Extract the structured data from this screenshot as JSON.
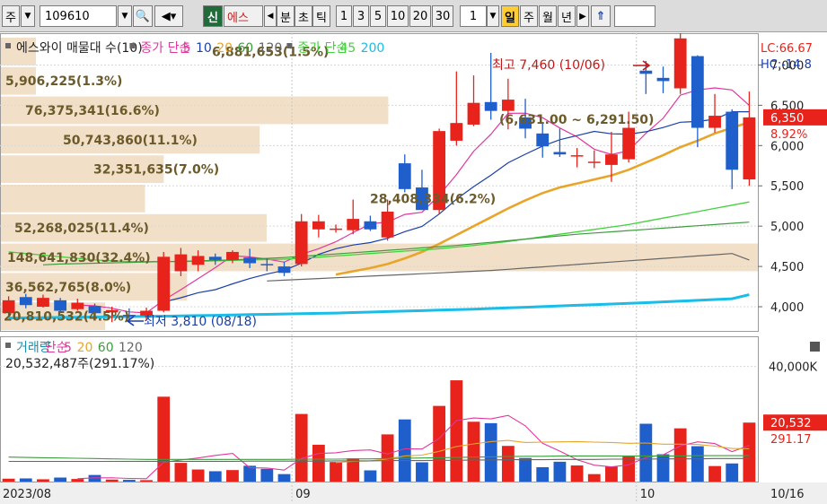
{
  "toolbar": {
    "market": "주",
    "code": "109610",
    "new_badge": "신",
    "name": "에스",
    "period_buttons": [
      "분",
      "초",
      "틱",
      "1",
      "3",
      "5",
      "10",
      "20",
      "30"
    ],
    "count": "1",
    "timeframes": [
      "일",
      "주",
      "월",
      "년"
    ],
    "selected_timeframe": "일"
  },
  "legend": {
    "price": {
      "name": "에스와이 매물대 수(10)",
      "ma_label": "종가 단순",
      "ma_periods": [
        "5",
        "10",
        "20",
        "60",
        "120"
      ],
      "ma_label2": "종가 단순",
      "ma_periods2": [
        "45",
        "200"
      ]
    },
    "volume": {
      "name": "거래량",
      "ma_label": "단순",
      "ma_periods": [
        "5",
        "20",
        "60",
        "120"
      ],
      "value": "20,532,487주(291.17%)"
    }
  },
  "colors": {
    "up": "#e8231b",
    "down": "#1f5fcc",
    "ma5": "#e0389e",
    "ma10": "#1a3fa8",
    "ma20": "#e8a52a",
    "ma60": "#3f9b3f",
    "ma120": "#666666",
    "ma45": "#44d13e",
    "ma200": "#19bde8",
    "volume_profile": "#f2dfc7"
  },
  "chart_data": [
    {
      "type": "candlestick",
      "title": "에스와이 매물대 수(10)",
      "x_labels": [
        "2023/08",
        "09",
        "10",
        "10/16"
      ],
      "ylim": [
        3700,
        7350
      ],
      "y_ticks": [
        "4,000",
        "4,500",
        "5,000",
        "5,500",
        "6,000",
        "6,500",
        "7,000"
      ],
      "candles": [
        {
          "o": 3920,
          "h": 4130,
          "l": 3880,
          "c": 4080
        },
        {
          "o": 4120,
          "h": 4160,
          "l": 3980,
          "c": 4020
        },
        {
          "o": 4000,
          "h": 4150,
          "l": 3990,
          "c": 4110
        },
        {
          "o": 4080,
          "h": 4110,
          "l": 3920,
          "c": 3950
        },
        {
          "o": 3970,
          "h": 4100,
          "l": 3950,
          "c": 4050
        },
        {
          "o": 4010,
          "h": 4040,
          "l": 3860,
          "c": 3920
        },
        {
          "o": 3930,
          "h": 4000,
          "l": 3810,
          "c": 3960
        },
        {
          "o": 3900,
          "h": 3980,
          "l": 3840,
          "c": 3880
        },
        {
          "o": 3890,
          "h": 3990,
          "l": 3830,
          "c": 3950
        },
        {
          "o": 3950,
          "h": 4680,
          "l": 3930,
          "c": 4620
        },
        {
          "o": 4440,
          "h": 4730,
          "l": 4380,
          "c": 4650
        },
        {
          "o": 4520,
          "h": 4700,
          "l": 4440,
          "c": 4630
        },
        {
          "o": 4620,
          "h": 4660,
          "l": 4520,
          "c": 4580
        },
        {
          "o": 4580,
          "h": 4700,
          "l": 4540,
          "c": 4680
        },
        {
          "o": 4610,
          "h": 4720,
          "l": 4480,
          "c": 4540
        },
        {
          "o": 4530,
          "h": 4600,
          "l": 4440,
          "c": 4520
        },
        {
          "o": 4500,
          "h": 4560,
          "l": 4380,
          "c": 4420
        },
        {
          "o": 4530,
          "h": 5150,
          "l": 4500,
          "c": 5060
        },
        {
          "o": 4960,
          "h": 5140,
          "l": 4860,
          "c": 5060
        },
        {
          "o": 4960,
          "h": 5020,
          "l": 4920,
          "c": 4970
        },
        {
          "o": 4950,
          "h": 5330,
          "l": 4900,
          "c": 5090
        },
        {
          "o": 5060,
          "h": 5130,
          "l": 4940,
          "c": 4960
        },
        {
          "o": 4860,
          "h": 5330,
          "l": 4820,
          "c": 5180
        },
        {
          "o": 5780,
          "h": 5890,
          "l": 5420,
          "c": 5460
        },
        {
          "o": 5480,
          "h": 5700,
          "l": 5200,
          "c": 5200
        },
        {
          "o": 5200,
          "h": 6210,
          "l": 5150,
          "c": 6180
        },
        {
          "o": 6060,
          "h": 6920,
          "l": 6000,
          "c": 6280
        },
        {
          "o": 6260,
          "h": 6870,
          "l": 6240,
          "c": 6530
        },
        {
          "o": 6540,
          "h": 7150,
          "l": 6320,
          "c": 6430
        },
        {
          "o": 6430,
          "h": 6830,
          "l": 6200,
          "c": 6570
        },
        {
          "o": 6350,
          "h": 6580,
          "l": 6090,
          "c": 6210
        },
        {
          "o": 6150,
          "h": 6280,
          "l": 5850,
          "c": 5990
        },
        {
          "o": 5920,
          "h": 6210,
          "l": 5860,
          "c": 5890
        },
        {
          "o": 5880,
          "h": 5970,
          "l": 5730,
          "c": 5880
        },
        {
          "o": 5800,
          "h": 5940,
          "l": 5720,
          "c": 5800
        },
        {
          "o": 5760,
          "h": 6170,
          "l": 5550,
          "c": 5890
        },
        {
          "o": 5830,
          "h": 6420,
          "l": 5790,
          "c": 6220
        },
        {
          "o": 6930,
          "h": 7050,
          "l": 6640,
          "c": 6890
        },
        {
          "o": 6840,
          "h": 6980,
          "l": 6650,
          "c": 6800
        },
        {
          "o": 6710,
          "h": 7460,
          "l": 6640,
          "c": 7330
        },
        {
          "o": 7110,
          "h": 7120,
          "l": 5980,
          "c": 6220
        },
        {
          "o": 6220,
          "h": 6640,
          "l": 6160,
          "c": 6370
        },
        {
          "o": 6420,
          "h": 6450,
          "l": 5460,
          "c": 5700
        },
        {
          "o": 5580,
          "h": 6670,
          "l": 5500,
          "c": 6350
        }
      ],
      "moving_averages": [
        {
          "name": "5",
          "values": [
            null,
            null,
            null,
            null,
            4022,
            4012,
            3982,
            3936,
            3924,
            4082,
            4212,
            4348,
            4486,
            4634,
            4618,
            4592,
            4554,
            4652,
            4720,
            4806,
            4920,
            5028,
            5052,
            5146,
            5172,
            5384,
            5640,
            5930,
            6140,
            6400,
            6402,
            6346,
            6218,
            6108,
            5954,
            5890,
            5936,
            6152,
            6338,
            6626,
            6690,
            6716,
            6690,
            6500
          ]
        },
        {
          "name": "10",
          "values": [
            null,
            null,
            null,
            null,
            null,
            null,
            null,
            null,
            null,
            4058,
            4112,
            4174,
            4212,
            4284,
            4350,
            4406,
            4452,
            4540,
            4650,
            4720,
            4766,
            4796,
            4850,
            4932,
            4996,
            5150,
            5334,
            5490,
            5632,
            5786,
            5892,
            5994,
            6072,
            6124,
            6176,
            6146,
            6142,
            6172,
            6224,
            6290,
            6300,
            6326,
            6420,
            6420
          ]
        },
        {
          "name": "20",
          "values": [
            null,
            null,
            null,
            null,
            null,
            null,
            null,
            null,
            null,
            null,
            null,
            null,
            null,
            null,
            null,
            null,
            null,
            null,
            null,
            4400,
            4440,
            4480,
            4530,
            4600,
            4680,
            4780,
            4890,
            5000,
            5110,
            5220,
            5320,
            5410,
            5480,
            5530,
            5580,
            5630,
            5700,
            5790,
            5880,
            5980,
            6060,
            6150,
            6220,
            6290
          ]
        },
        {
          "name": "45",
          "values": [
            4680,
            4660,
            4640,
            4620,
            4600,
            4580,
            4570,
            4560,
            4560,
            4560,
            4560,
            4565,
            4570,
            4575,
            4580,
            4585,
            4590,
            4600,
            4615,
            4630,
            4645,
            4660,
            4675,
            4690,
            4705,
            4720,
            4740,
            4760,
            4785,
            4810,
            4840,
            4870,
            4900,
            4930,
            4960,
            4990,
            5020,
            5060,
            5100,
            5140,
            5180,
            5220,
            5260,
            5300
          ]
        },
        {
          "name": "60",
          "values": [
            null,
            null,
            4520,
            4530,
            4535,
            4540,
            4545,
            4550,
            4555,
            4560,
            4565,
            4570,
            4575,
            4580,
            4590,
            4600,
            4610,
            4625,
            4640,
            4655,
            4670,
            4685,
            4700,
            4715,
            4730,
            4745,
            4760,
            4780,
            4800,
            4820,
            4840,
            4860,
            4880,
            4900,
            4915,
            4930,
            4945,
            4960,
            4975,
            4990,
            5005,
            5020,
            5035,
            5050
          ]
        },
        {
          "name": "120",
          "values": [
            null,
            null,
            null,
            null,
            null,
            null,
            null,
            null,
            null,
            null,
            null,
            null,
            null,
            null,
            null,
            4320,
            4330,
            4340,
            4350,
            4360,
            4370,
            4380,
            4390,
            4400,
            4410,
            4420,
            4430,
            4440,
            4450,
            4465,
            4480,
            4495,
            4510,
            4525,
            4540,
            4555,
            4570,
            4585,
            4600,
            4615,
            4630,
            4645,
            4660,
            4580
          ]
        },
        {
          "name": "200",
          "values": [
            3860,
            3862,
            3865,
            3868,
            3870,
            3872,
            3875,
            3878,
            3880,
            3883,
            3886,
            3890,
            3894,
            3898,
            3902,
            3906,
            3910,
            3914,
            3918,
            3922,
            3928,
            3934,
            3940,
            3946,
            3952,
            3958,
            3964,
            3970,
            3978,
            3986,
            3994,
            4002,
            4010,
            4018,
            4026,
            4034,
            4042,
            4050,
            4060,
            4070,
            4080,
            4090,
            4100,
            4150
          ]
        }
      ],
      "volume_profile": [
        {
          "label": "20,810,532(4.5%)",
          "pct": 4.5
        },
        {
          "label": "36,562,765(8.0%)",
          "pct": 8.0
        },
        {
          "label": "148,641,830(32.4%)",
          "pct": 32.4
        },
        {
          "label": "52,268,025(11.4%)",
          "pct": 11.4
        },
        {
          "label": "28,408,334(6.2%)",
          "pct": 6.2
        },
        {
          "label": "32,351,635(7.0%)",
          "pct": 7.0
        },
        {
          "label": "50,743,860(11.1%)",
          "pct": 11.1
        },
        {
          "label": "76,375,341(16.6%)",
          "pct": 16.6
        },
        {
          "label": "5,906,225(1.3%)",
          "pct": 1.3
        },
        {
          "label": "6,881,653(1.5%)",
          "pct": 1.5
        }
      ],
      "annotations": {
        "high": "최고 7,460 (10/06)",
        "low": "최저 3,810 (08/18)",
        "range_box": "(6,631.00 ~ 6,291.50)"
      },
      "right_labels": {
        "lc": "LC:66.67",
        "hc": "HC:-14.8",
        "current_price": "6,350",
        "change_pct": "8.92%"
      }
    },
    {
      "type": "bar",
      "title": "거래량",
      "ylim": [
        0,
        48000000
      ],
      "y_ticks": [
        "40,000K"
      ],
      "values": [
        1.0,
        1.1,
        0.8,
        1.4,
        0.9,
        2.3,
        0.7,
        0.6,
        0.5,
        29.5,
        6.5,
        4.2,
        3.6,
        4.0,
        5.5,
        4.4,
        2.6,
        23.5,
        12.8,
        6.8,
        8.1,
        3.9,
        16.4,
        21.6,
        6.7,
        26.3,
        35.2,
        20.8,
        20.3,
        12.4,
        8.2,
        5.0,
        6.9,
        5.6,
        2.6,
        5.2,
        8.7,
        20.1,
        9.5,
        18.5,
        12.3,
        5.4,
        6.3,
        20.5
      ],
      "values_unit": "millions",
      "volume_ma": [
        {
          "name": "5",
          "values": [
            null,
            null,
            null,
            null,
            1.0,
            1.3,
            1.3,
            1.1,
            1.0,
            6.7,
            7.5,
            8.2,
            9.1,
            9.8,
            4.8,
            4.7,
            4.0,
            8.0,
            9.8,
            10.0,
            10.8,
            11.0,
            9.6,
            11.4,
            11.3,
            15.0,
            21.2,
            22.1,
            21.8,
            23.0,
            19.4,
            13.3,
            10.6,
            7.6,
            5.7,
            5.1,
            5.8,
            8.4,
            9.3,
            12.4,
            13.8,
            13.2,
            10.4,
            12.6
          ]
        },
        {
          "name": "20",
          "values": [
            null,
            null,
            null,
            null,
            null,
            null,
            null,
            null,
            null,
            null,
            null,
            null,
            null,
            null,
            null,
            null,
            null,
            null,
            null,
            6.6,
            7.0,
            7.2,
            7.9,
            8.9,
            9.2,
            10.5,
            12.2,
            13.1,
            13.9,
            14.3,
            13.6,
            13.7,
            13.8,
            13.9,
            13.7,
            13.6,
            13.3,
            13.4,
            13.0,
            13.0,
            12.9,
            12.3,
            11.5,
            11.4
          ]
        },
        {
          "name": "60",
          "values": [
            8.5,
            8.4,
            8.3,
            8.2,
            8.1,
            8.0,
            7.9,
            7.8,
            7.7,
            7.7,
            7.7,
            7.7,
            7.7,
            7.7,
            7.7,
            7.7,
            7.7,
            7.8,
            7.8,
            7.8,
            7.9,
            7.9,
            8.0,
            8.1,
            8.2,
            8.3,
            8.4,
            8.5,
            8.6,
            8.7,
            8.8,
            8.8,
            8.9,
            8.9,
            8.9,
            8.9,
            8.9,
            8.9,
            8.9,
            8.9,
            9.0,
            9.0,
            9.0,
            9.0
          ]
        },
        {
          "name": "120",
          "values": [
            7.0,
            7.0,
            7.0,
            7.0,
            7.0,
            7.0,
            7.0,
            7.0,
            7.0,
            7.0,
            7.0,
            7.0,
            7.0,
            7.0,
            7.1,
            7.1,
            7.1,
            7.1,
            7.1,
            7.2,
            7.2,
            7.2,
            7.3,
            7.3,
            7.3,
            7.4,
            7.4,
            7.5,
            7.5,
            7.6,
            7.6,
            7.6,
            7.7,
            7.7,
            7.7,
            7.8,
            7.8,
            7.8,
            7.9,
            7.9,
            7.9,
            8.0,
            8.0,
            8.0
          ]
        }
      ],
      "right_labels": {
        "volume": "20,532",
        "pct": "291.17"
      }
    }
  ]
}
